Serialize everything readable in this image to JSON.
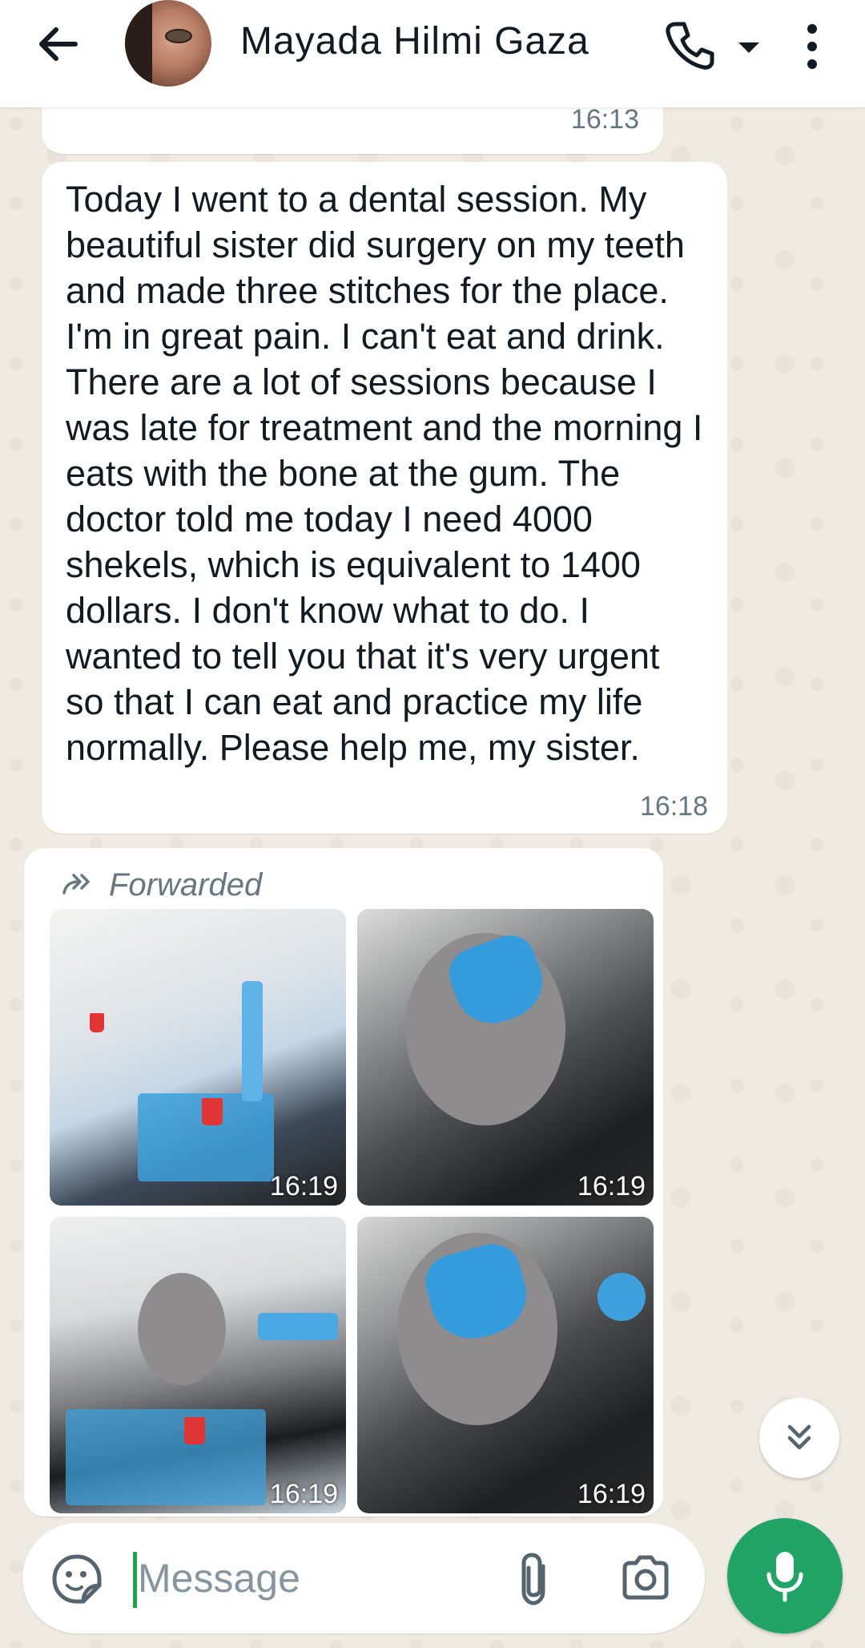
{
  "header": {
    "contact_name": "Mayada Hilmi Gaza",
    "back_icon": "arrow-left-icon",
    "call_icon": "phone-icon",
    "call_menu_icon": "caret-down-icon",
    "more_icon": "more-vertical-icon"
  },
  "messages": [
    {
      "type": "text",
      "time": "16:13",
      "text": ""
    },
    {
      "type": "text",
      "time": "16:18",
      "text": "Today I went to a dental session. My beautiful sister did surgery on my teeth and made three stitches for the place. I'm in great pain. I can't eat and drink. There are a lot of sessions because I was late for treatment and the morning I eats with the bone at the gum. The doctor told me today I need 4000 shekels, which is equivalent to 1400 dollars. I don't know what to do. I wanted to tell you that it's very urgent so that I can eat and practice my life normally. Please help me, my sister."
    },
    {
      "type": "media",
      "forwarded_label": "Forwarded",
      "photos": [
        {
          "time": "16:19"
        },
        {
          "time": "16:19"
        },
        {
          "time": "16:19"
        },
        {
          "time": "16:19"
        }
      ]
    }
  ],
  "composer": {
    "placeholder": "Message",
    "value": ""
  },
  "colors": {
    "accent": "#21a366",
    "chat_background": "#efeae2",
    "bubble": "#ffffff",
    "timestamp": "#667781"
  }
}
